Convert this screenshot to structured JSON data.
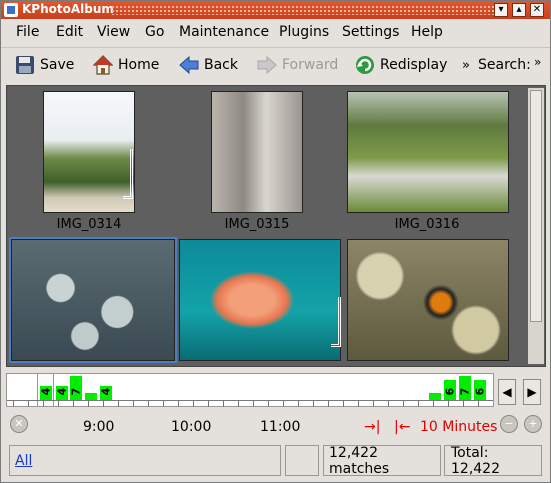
{
  "window": {
    "title": "KPhotoAlbum",
    "controls": [
      "▾",
      "▴",
      "✕"
    ]
  },
  "menu": [
    "File",
    "Edit",
    "View",
    "Go",
    "Maintenance",
    "Plugins",
    "Settings",
    "Help"
  ],
  "toolbar": {
    "save": "Save",
    "home": "Home",
    "back": "Back",
    "forward": "Forward",
    "redisplay": "Redisplay",
    "overflow": "»",
    "search_label": "Search:",
    "search_overflow": "»"
  },
  "thumbnails": [
    {
      "label": "IMG_0314"
    },
    {
      "label": "IMG_0315"
    },
    {
      "label": "IMG_0316"
    },
    {
      "label": ""
    },
    {
      "label": ""
    },
    {
      "label": ""
    }
  ],
  "timeline": {
    "bars": [
      {
        "count": "4",
        "value": 4
      },
      {
        "count": "4",
        "value": 4
      },
      {
        "count": "7",
        "value": 7
      },
      {
        "count": "",
        "value": 2
      },
      {
        "count": "4",
        "value": 4
      },
      {
        "count": "",
        "value": 2
      },
      {
        "count": "6",
        "value": 6
      },
      {
        "count": "7",
        "value": 7
      },
      {
        "count": "6",
        "value": 6
      }
    ],
    "time_labels": [
      "9:00",
      "10:00",
      "11:00"
    ],
    "range_label": "10 Minutes",
    "nav_prev": "◀",
    "nav_next": "▶"
  },
  "status": {
    "filter": "All",
    "matches": "12,422 matches",
    "total": "Total: 12,422"
  },
  "colors": {
    "title_bar": "#d4491f",
    "bar": "#00ef00",
    "range": "#e00000",
    "link": "#1a3cc2",
    "selection": "#4a7fc1"
  }
}
